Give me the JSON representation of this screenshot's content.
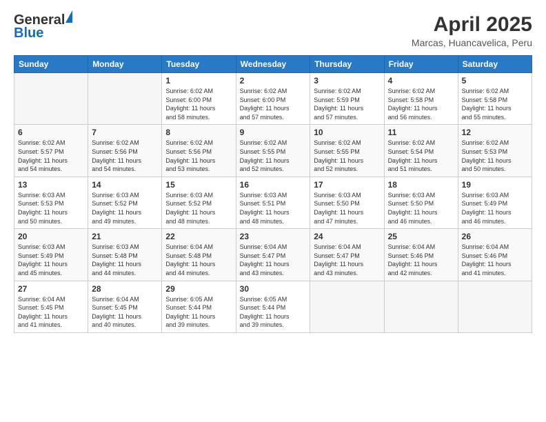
{
  "header": {
    "logo_general": "General",
    "logo_blue": "Blue",
    "month_title": "April 2025",
    "location": "Marcas, Huancavelica, Peru"
  },
  "weekdays": [
    "Sunday",
    "Monday",
    "Tuesday",
    "Wednesday",
    "Thursday",
    "Friday",
    "Saturday"
  ],
  "weeks": [
    [
      {
        "day": "",
        "info": ""
      },
      {
        "day": "",
        "info": ""
      },
      {
        "day": "1",
        "info": "Sunrise: 6:02 AM\nSunset: 6:00 PM\nDaylight: 11 hours\nand 58 minutes."
      },
      {
        "day": "2",
        "info": "Sunrise: 6:02 AM\nSunset: 6:00 PM\nDaylight: 11 hours\nand 57 minutes."
      },
      {
        "day": "3",
        "info": "Sunrise: 6:02 AM\nSunset: 5:59 PM\nDaylight: 11 hours\nand 57 minutes."
      },
      {
        "day": "4",
        "info": "Sunrise: 6:02 AM\nSunset: 5:58 PM\nDaylight: 11 hours\nand 56 minutes."
      },
      {
        "day": "5",
        "info": "Sunrise: 6:02 AM\nSunset: 5:58 PM\nDaylight: 11 hours\nand 55 minutes."
      }
    ],
    [
      {
        "day": "6",
        "info": "Sunrise: 6:02 AM\nSunset: 5:57 PM\nDaylight: 11 hours\nand 54 minutes."
      },
      {
        "day": "7",
        "info": "Sunrise: 6:02 AM\nSunset: 5:56 PM\nDaylight: 11 hours\nand 54 minutes."
      },
      {
        "day": "8",
        "info": "Sunrise: 6:02 AM\nSunset: 5:56 PM\nDaylight: 11 hours\nand 53 minutes."
      },
      {
        "day": "9",
        "info": "Sunrise: 6:02 AM\nSunset: 5:55 PM\nDaylight: 11 hours\nand 52 minutes."
      },
      {
        "day": "10",
        "info": "Sunrise: 6:02 AM\nSunset: 5:55 PM\nDaylight: 11 hours\nand 52 minutes."
      },
      {
        "day": "11",
        "info": "Sunrise: 6:02 AM\nSunset: 5:54 PM\nDaylight: 11 hours\nand 51 minutes."
      },
      {
        "day": "12",
        "info": "Sunrise: 6:02 AM\nSunset: 5:53 PM\nDaylight: 11 hours\nand 50 minutes."
      }
    ],
    [
      {
        "day": "13",
        "info": "Sunrise: 6:03 AM\nSunset: 5:53 PM\nDaylight: 11 hours\nand 50 minutes."
      },
      {
        "day": "14",
        "info": "Sunrise: 6:03 AM\nSunset: 5:52 PM\nDaylight: 11 hours\nand 49 minutes."
      },
      {
        "day": "15",
        "info": "Sunrise: 6:03 AM\nSunset: 5:52 PM\nDaylight: 11 hours\nand 48 minutes."
      },
      {
        "day": "16",
        "info": "Sunrise: 6:03 AM\nSunset: 5:51 PM\nDaylight: 11 hours\nand 48 minutes."
      },
      {
        "day": "17",
        "info": "Sunrise: 6:03 AM\nSunset: 5:50 PM\nDaylight: 11 hours\nand 47 minutes."
      },
      {
        "day": "18",
        "info": "Sunrise: 6:03 AM\nSunset: 5:50 PM\nDaylight: 11 hours\nand 46 minutes."
      },
      {
        "day": "19",
        "info": "Sunrise: 6:03 AM\nSunset: 5:49 PM\nDaylight: 11 hours\nand 46 minutes."
      }
    ],
    [
      {
        "day": "20",
        "info": "Sunrise: 6:03 AM\nSunset: 5:49 PM\nDaylight: 11 hours\nand 45 minutes."
      },
      {
        "day": "21",
        "info": "Sunrise: 6:03 AM\nSunset: 5:48 PM\nDaylight: 11 hours\nand 44 minutes."
      },
      {
        "day": "22",
        "info": "Sunrise: 6:04 AM\nSunset: 5:48 PM\nDaylight: 11 hours\nand 44 minutes."
      },
      {
        "day": "23",
        "info": "Sunrise: 6:04 AM\nSunset: 5:47 PM\nDaylight: 11 hours\nand 43 minutes."
      },
      {
        "day": "24",
        "info": "Sunrise: 6:04 AM\nSunset: 5:47 PM\nDaylight: 11 hours\nand 43 minutes."
      },
      {
        "day": "25",
        "info": "Sunrise: 6:04 AM\nSunset: 5:46 PM\nDaylight: 11 hours\nand 42 minutes."
      },
      {
        "day": "26",
        "info": "Sunrise: 6:04 AM\nSunset: 5:46 PM\nDaylight: 11 hours\nand 41 minutes."
      }
    ],
    [
      {
        "day": "27",
        "info": "Sunrise: 6:04 AM\nSunset: 5:45 PM\nDaylight: 11 hours\nand 41 minutes."
      },
      {
        "day": "28",
        "info": "Sunrise: 6:04 AM\nSunset: 5:45 PM\nDaylight: 11 hours\nand 40 minutes."
      },
      {
        "day": "29",
        "info": "Sunrise: 6:05 AM\nSunset: 5:44 PM\nDaylight: 11 hours\nand 39 minutes."
      },
      {
        "day": "30",
        "info": "Sunrise: 6:05 AM\nSunset: 5:44 PM\nDaylight: 11 hours\nand 39 minutes."
      },
      {
        "day": "",
        "info": ""
      },
      {
        "day": "",
        "info": ""
      },
      {
        "day": "",
        "info": ""
      }
    ]
  ]
}
